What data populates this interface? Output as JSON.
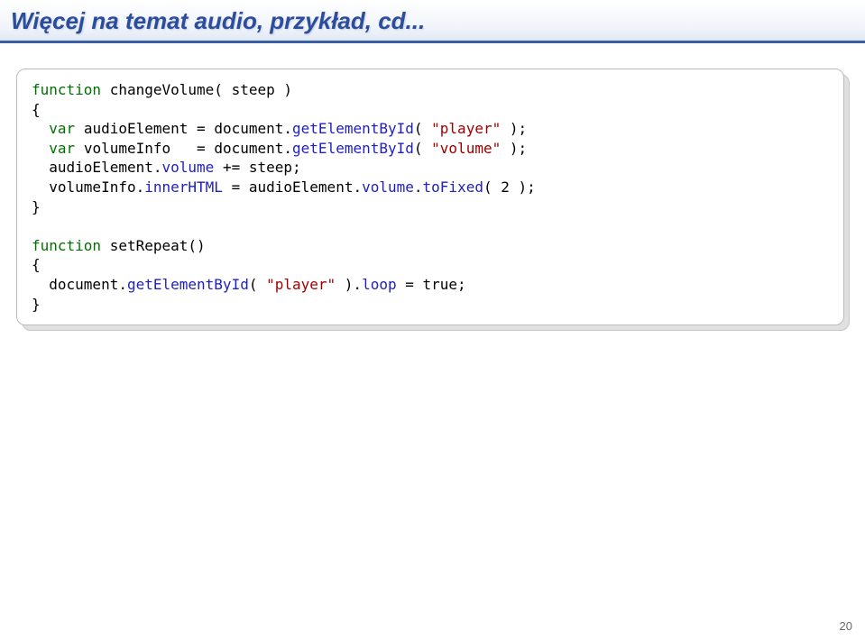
{
  "title": "Więcej na temat audio, przykład, cd...",
  "page_number": "20",
  "code": {
    "fn1": {
      "kw_function": "function",
      "name": "changeVolume",
      "param": "steep",
      "kw_var1": "var",
      "v1_lhs": "audioElement",
      "v1_eq": "=",
      "v1_obj": "document",
      "v1_method": "getElementById",
      "v1_arg": "\"player\"",
      "kw_var2": "var",
      "v2_lhs": "volumeInfo",
      "v2_eq": "=",
      "v2_obj": "document",
      "v2_method": "getElementById",
      "v2_arg": "\"volume\"",
      "s3_obj": "audioElement",
      "s3_prop": "volume",
      "s3_op": "+=",
      "s3_rhs": "steep",
      "s4_obj": "volumeInfo",
      "s4_prop": "innerHTML",
      "s4_eq": "=",
      "s4_robj": "audioElement",
      "s4_rprop": "volume",
      "s4_method": "toFixed",
      "s4_arg": "2"
    },
    "fn2": {
      "kw_function": "function",
      "name": "setRepeat",
      "s1_obj": "document",
      "s1_method": "getElementById",
      "s1_arg": "\"player\"",
      "s1_prop": "loop",
      "s1_eq": "=",
      "s1_rhs": "true"
    }
  }
}
